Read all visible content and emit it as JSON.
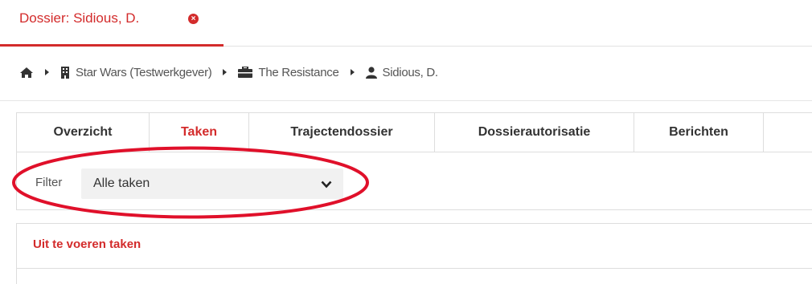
{
  "dossier_tab": {
    "label": "Dossier: Sidious, D.",
    "accent": "#d32b2b"
  },
  "breadcrumb": {
    "items": [
      {
        "icon": "home-icon",
        "label": ""
      },
      {
        "icon": "building-icon",
        "label": "Star Wars (Testwerkgever)"
      },
      {
        "icon": "briefcase-icon",
        "label": "The Resistance"
      },
      {
        "icon": "user-icon",
        "label": "Sidious, D."
      }
    ]
  },
  "tabs": [
    {
      "label": "Overzicht",
      "active": false
    },
    {
      "label": "Taken",
      "active": true
    },
    {
      "label": "Trajectendossier",
      "active": false
    },
    {
      "label": "Dossierautorisatie",
      "active": false
    },
    {
      "label": "Berichten",
      "active": false
    }
  ],
  "filter": {
    "label": "Filter",
    "selected": "Alle taken"
  },
  "section": {
    "title": "Uit te voeren taken"
  }
}
